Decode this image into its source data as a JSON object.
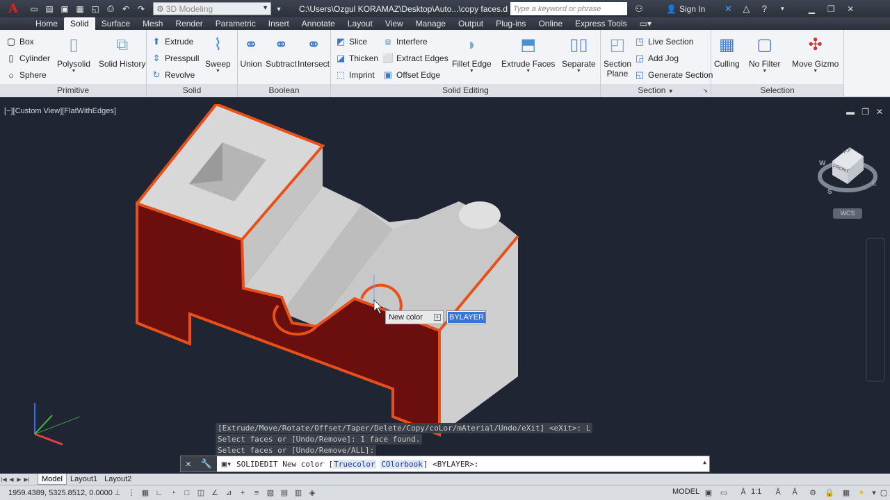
{
  "titlebar": {
    "logo": "A",
    "workspace": "3D Modeling",
    "filepath": "C:\\Users\\Ozgul KORAMAZ\\Desktop\\Auto...\\copy faces.dwg",
    "search_placeholder": "Type a keyword or phrase",
    "signin": "Sign In"
  },
  "tabs": [
    "Home",
    "Solid",
    "Surface",
    "Mesh",
    "Render",
    "Parametric",
    "Insert",
    "Annotate",
    "Layout",
    "View",
    "Manage",
    "Output",
    "Plug-ins",
    "Online",
    "Express Tools"
  ],
  "active_tab": "Solid",
  "ribbon": {
    "primitive": {
      "title": "Primitive",
      "box": "Box",
      "cylinder": "Cylinder",
      "sphere": "Sphere",
      "polysolid": "Polysolid",
      "solid_history": "Solid History"
    },
    "solid": {
      "title": "Solid",
      "extrude": "Extrude",
      "presspull": "Presspull",
      "revolve": "Revolve",
      "sweep": "Sweep"
    },
    "boolean": {
      "title": "Boolean",
      "union": "Union",
      "subtract": "Subtract",
      "intersect": "Intersect"
    },
    "solid_editing": {
      "title": "Solid Editing",
      "slice": "Slice",
      "thicken": "Thicken",
      "imprint": "Imprint",
      "interfere": "Interfere",
      "extract_edges": "Extract Edges",
      "offset_edge": "Offset Edge",
      "fillet_edge": "Fillet Edge",
      "extrude_faces": "Extrude Faces",
      "separate": "Separate"
    },
    "section": {
      "title": "Section",
      "section_plane": "Section\nPlane",
      "live_section": "Live Section",
      "add_jog": "Add Jog",
      "generate_section": "Generate Section"
    },
    "selection": {
      "title": "Selection",
      "culling": "Culling",
      "no_filter": "No Filter",
      "move_gizmo": "Move Gizmo"
    }
  },
  "viewport": {
    "label": "[−][Custom View][FlatWithEdges]",
    "viewcube": {
      "top": "TOP",
      "front": "FRONT",
      "w": "W",
      "s": "S",
      "e": "E",
      "wcs": "WCS"
    }
  },
  "tooltip": {
    "label": "New color",
    "value": "BYLAYER"
  },
  "history": [
    "[Extrude/Move/Rotate/Offset/Taper/Delete/Copy/coLor/mAterial/Undo/eXit] <eXit>: L",
    "Select faces or [Undo/Remove]: 1 face found.",
    "Select faces or [Undo/Remove/ALL]:"
  ],
  "cmdline": {
    "prefix": "SOLIDEDIT New color [",
    "opt1": "Truecolor",
    "sep": " ",
    "opt2": "COlorbook",
    "suffix": "] <BYLAYER>:"
  },
  "layout_tabs": [
    "Model",
    "Layout1",
    "Layout2"
  ],
  "active_layout": "Model",
  "status": {
    "coords": "1959.4389, 5325.8512, 0.0000",
    "model": "MODEL",
    "scale": "1:1"
  },
  "colors": {
    "face_selected": "#6b0e0e",
    "edge_highlight": "#e8501a",
    "solid_face": "#d9d9d9",
    "viewport_bg": "#1f2533"
  }
}
